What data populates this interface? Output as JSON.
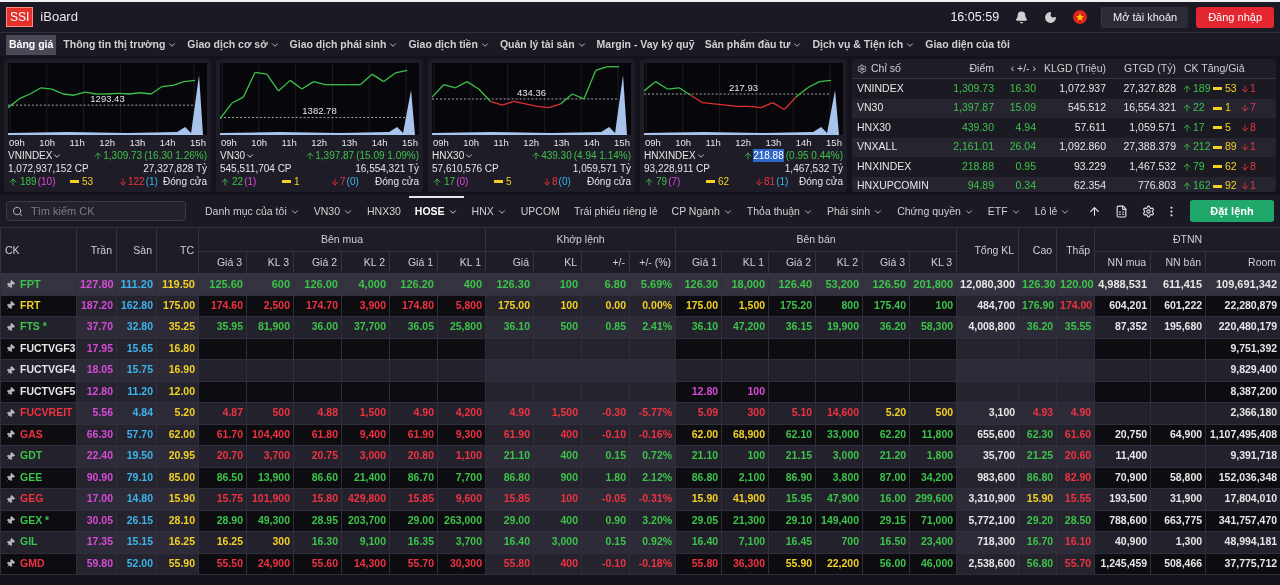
{
  "header": {
    "logo": "SSI",
    "app_name": "iBoard",
    "time": "16:05:59",
    "open_account": "Mở tài khoản",
    "login": "Đăng nhập"
  },
  "nav": [
    {
      "label": "Bảng giá",
      "selected": true,
      "has_menu": false
    },
    {
      "label": "Thông tin thị trường",
      "selected": false,
      "has_menu": true
    },
    {
      "label": "Giao dịch cơ sở",
      "selected": false,
      "has_menu": true
    },
    {
      "label": "Giao dịch phái sinh",
      "selected": false,
      "has_menu": true
    },
    {
      "label": "Giao dịch tiền",
      "selected": false,
      "has_menu": true
    },
    {
      "label": "Quản lý tài sản",
      "selected": false,
      "has_menu": true
    },
    {
      "label": "Margin - Vay ký quỹ",
      "selected": false,
      "has_menu": false
    },
    {
      "label": "Sản phẩm đầu tư",
      "selected": false,
      "has_menu": true
    },
    {
      "label": "Dịch vụ & Tiện ích",
      "selected": false,
      "has_menu": true
    },
    {
      "label": "Giao diện của tôi",
      "selected": false,
      "has_menu": false
    }
  ],
  "index_cards": [
    {
      "name": "VNINDEX",
      "ref_label": "1293.43",
      "times": [
        "09h",
        "10h",
        "11h",
        "12h",
        "13h",
        "14h",
        "15h"
      ],
      "price": "1,309.73",
      "price_selected": false,
      "change": "(16.30 1.26%)",
      "volume": "1,072,937,152 CP",
      "value": "27,327,828 Tỷ",
      "advances": "189",
      "ceiling": "(10)",
      "unchanged": "53",
      "declines": "122",
      "floor": "(1)",
      "status": "Đóng cửa"
    },
    {
      "name": "VN30",
      "ref_label": "1382.78",
      "times": [
        "09h",
        "10h",
        "11h",
        "12h",
        "13h",
        "14h",
        "15h"
      ],
      "price": "1,397.87",
      "price_selected": false,
      "change": "(15.09 1.09%)",
      "volume": "545,511,704 CP",
      "value": "16,554,321 Tỷ",
      "advances": "22",
      "ceiling": "(1)",
      "unchanged": "1",
      "declines": "7",
      "floor": "(0)",
      "status": "Đóng cửa"
    },
    {
      "name": "HNX30",
      "ref_label": "434.36",
      "times": [
        "09h",
        "10h",
        "11h",
        "12h",
        "13h",
        "14h",
        "15h"
      ],
      "price": "439.30",
      "price_selected": false,
      "change": "(4.94 1.14%)",
      "volume": "57,610,576 CP",
      "value": "1,059,571 Tỷ",
      "advances": "17",
      "ceiling": "(0)",
      "unchanged": "5",
      "declines": "8",
      "floor": "(0)",
      "status": "Đóng cửa"
    },
    {
      "name": "HNXINDEX",
      "ref_label": "217.93",
      "times": [
        "09h",
        "10h",
        "11h",
        "12h",
        "13h",
        "14h",
        "15h"
      ],
      "price": "218.88",
      "price_selected": true,
      "change": "(0.95 0.44%)",
      "volume": "93,228,911 CP",
      "value": "1,467,532 Tỷ",
      "advances": "79",
      "ceiling": "(7)",
      "unchanged": "62",
      "declines": "81",
      "floor": "(1)",
      "status": "Đóng cửa"
    }
  ],
  "index_table": {
    "columns": [
      "Chỉ số",
      "Điểm",
      "‹ +/- ›",
      "KLGD (Triệu)",
      "GTGD (Tỷ)",
      "CK Tăng/Giả"
    ],
    "rows": [
      {
        "name": "VNINDEX",
        "points": "1,309.73",
        "change": "16.30",
        "volume": "1,072.937",
        "value": "27,327.828",
        "advances": "189",
        "unchanged": "53",
        "declines": "1"
      },
      {
        "name": "VN30",
        "points": "1,397.87",
        "change": "15.09",
        "volume": "545.512",
        "value": "16,554.321",
        "advances": "22",
        "unchanged": "1",
        "declines": "7"
      },
      {
        "name": "HNX30",
        "points": "439.30",
        "change": "4.94",
        "volume": "57.611",
        "value": "1,059.571",
        "advances": "17",
        "unchanged": "5",
        "declines": "8"
      },
      {
        "name": "VNXALL",
        "points": "2,161.01",
        "change": "26.04",
        "volume": "1,092.860",
        "value": "27,388.379",
        "advances": "212",
        "unchanged": "89",
        "declines": "1"
      },
      {
        "name": "HNXINDEX",
        "points": "218.88",
        "change": "0.95",
        "volume": "93.229",
        "value": "1,467.532",
        "advances": "79",
        "unchanged": "62",
        "declines": "8"
      },
      {
        "name": "HNXUPCOMIN",
        "points": "94.89",
        "change": "0.34",
        "volume": "62.354",
        "value": "776.803",
        "advances": "162",
        "unchanged": "92",
        "declines": "1"
      }
    ]
  },
  "search": {
    "placeholder": "Tìm kiếm CK"
  },
  "filters": [
    {
      "label": "Danh mục của tôi",
      "selected": false,
      "has_menu": true
    },
    {
      "label": "VN30",
      "selected": false,
      "has_menu": true
    },
    {
      "label": "HNX30",
      "selected": false,
      "has_menu": false
    },
    {
      "label": "HOSE",
      "selected": true,
      "has_menu": true
    },
    {
      "label": "HNX",
      "selected": false,
      "has_menu": true
    },
    {
      "label": "UPCOM",
      "selected": false,
      "has_menu": false
    },
    {
      "label": "Trái phiếu riêng lẻ",
      "selected": false,
      "has_menu": false
    },
    {
      "label": "CP Ngành",
      "selected": false,
      "has_menu": true
    },
    {
      "label": "Thỏa thuận",
      "selected": false,
      "has_menu": true
    },
    {
      "label": "Phái sinh",
      "selected": false,
      "has_menu": true
    },
    {
      "label": "Chứng quyền",
      "selected": false,
      "has_menu": true
    },
    {
      "label": "ETF",
      "selected": false,
      "has_menu": true
    },
    {
      "label": "Lô lẻ",
      "selected": false,
      "has_menu": true
    }
  ],
  "order_button": "Đặt lệnh",
  "table": {
    "columns": [
      {
        "label": "CK"
      },
      {
        "label": "Trần"
      },
      {
        "label": "Sàn"
      },
      {
        "label": "TC"
      },
      {
        "label": "Bên mua",
        "colspan": 6,
        "sub": [
          "Giá 3",
          "KL 3",
          "Giá 2",
          "KL 2",
          "Giá 1",
          "KL 1"
        ]
      },
      {
        "label": "Khớp lệnh",
        "colspan": 4,
        "sub": [
          "Giá",
          "KL",
          "+/-",
          "+/- (%)"
        ]
      },
      {
        "label": "Bên bán",
        "colspan": 6,
        "sub": [
          "Giá 1",
          "KL 1",
          "Giá 2",
          "KL 2",
          "Giá 3",
          "KL 3"
        ]
      },
      {
        "label": "Tổng KL"
      },
      {
        "label": "Cao"
      },
      {
        "label": "Thấp"
      },
      {
        "label": "ĐTNN",
        "colspan": 3,
        "sub": [
          "NN mua",
          "NN bán",
          "Room"
        ]
      }
    ],
    "rows": [
      {
        "selected": true,
        "cells": [
          {
            "text": "FPT",
            "color": "#3dc24a"
          },
          {
            "text": "127.80",
            "color": "#d84ad8"
          },
          {
            "text": "111.20",
            "color": "#3cb4ea"
          },
          {
            "text": "119.50",
            "color": "#f2d024"
          },
          {
            "text": "125.60",
            "color": "#3dc24a"
          },
          {
            "text": "600",
            "color": "#3dc24a"
          },
          {
            "text": "126.00",
            "color": "#3dc24a"
          },
          {
            "text": "4,000",
            "color": "#3dc24a"
          },
          {
            "text": "126.20",
            "color": "#3dc24a"
          },
          {
            "text": "400",
            "color": "#3dc24a"
          },
          {
            "text": "126.30",
            "color": "#3dc24a"
          },
          {
            "text": "100",
            "color": "#3dc24a"
          },
          {
            "text": "6.80",
            "color": "#3dc24a"
          },
          {
            "text": "5.69%",
            "color": "#3dc24a"
          },
          {
            "text": "126.30",
            "color": "#3dc24a"
          },
          {
            "text": "18,000",
            "color": "#3dc24a"
          },
          {
            "text": "126.40",
            "color": "#3dc24a"
          },
          {
            "text": "53,200",
            "color": "#3dc24a"
          },
          {
            "text": "126.50",
            "color": "#3dc24a"
          },
          {
            "text": "201,800",
            "color": "#3dc24a"
          },
          {
            "text": "12,080,300",
            "color": "#e6e6e6"
          },
          {
            "text": "126.30",
            "color": "#3dc24a"
          },
          {
            "text": "120.00",
            "color": "#3dc24a"
          },
          {
            "text": "4,988,531",
            "color": "#e6e6e6"
          },
          {
            "text": "611,415",
            "color": "#e6e6e6"
          },
          {
            "text": "109,691,342",
            "color": "#e6e6e6"
          }
        ]
      },
      {
        "selected": false,
        "cells": [
          {
            "text": "FRT",
            "color": "#f2d024"
          },
          {
            "text": "187.20",
            "color": "#d84ad8"
          },
          {
            "text": "162.80",
            "color": "#3cb4ea"
          },
          {
            "text": "175.00",
            "color": "#f2d024"
          },
          {
            "text": "174.60",
            "color": "#ee3340"
          },
          {
            "text": "2,500",
            "color": "#ee3340"
          },
          {
            "text": "174.70",
            "color": "#ee3340"
          },
          {
            "text": "3,900",
            "color": "#ee3340"
          },
          {
            "text": "174.80",
            "color": "#ee3340"
          },
          {
            "text": "5,800",
            "color": "#ee3340"
          },
          {
            "text": "175.00",
            "color": "#f2d024"
          },
          {
            "text": "100",
            "color": "#f2d024"
          },
          {
            "text": "0.00",
            "color": "#f2d024"
          },
          {
            "text": "0.00%",
            "color": "#f2d024"
          },
          {
            "text": "175.00",
            "color": "#f2d024"
          },
          {
            "text": "1,500",
            "color": "#f2d024"
          },
          {
            "text": "175.20",
            "color": "#3dc24a"
          },
          {
            "text": "800",
            "color": "#3dc24a"
          },
          {
            "text": "175.40",
            "color": "#3dc24a"
          },
          {
            "text": "100",
            "color": "#3dc24a"
          },
          {
            "text": "484,700",
            "color": "#e6e6e6"
          },
          {
            "text": "176.90",
            "color": "#3dc24a"
          },
          {
            "text": "174.00",
            "color": "#ee3340"
          },
          {
            "text": "604,201",
            "color": "#e6e6e6"
          },
          {
            "text": "601,222",
            "color": "#e6e6e6"
          },
          {
            "text": "22,280,879",
            "color": "#e6e6e6"
          }
        ]
      },
      {
        "selected": false,
        "cells": [
          {
            "text": "FTS *",
            "color": "#3dc24a"
          },
          {
            "text": "37.70",
            "color": "#d84ad8"
          },
          {
            "text": "32.80",
            "color": "#3cb4ea"
          },
          {
            "text": "35.25",
            "color": "#f2d024"
          },
          {
            "text": "35.95",
            "color": "#3dc24a"
          },
          {
            "text": "81,900",
            "color": "#3dc24a"
          },
          {
            "text": "36.00",
            "color": "#3dc24a"
          },
          {
            "text": "37,700",
            "color": "#3dc24a"
          },
          {
            "text": "36.05",
            "color": "#3dc24a"
          },
          {
            "text": "25,800",
            "color": "#3dc24a"
          },
          {
            "text": "36.10",
            "color": "#3dc24a"
          },
          {
            "text": "500",
            "color": "#3dc24a"
          },
          {
            "text": "0.85",
            "color": "#3dc24a"
          },
          {
            "text": "2.41%",
            "color": "#3dc24a"
          },
          {
            "text": "36.10",
            "color": "#3dc24a"
          },
          {
            "text": "47,200",
            "color": "#3dc24a"
          },
          {
            "text": "36.15",
            "color": "#3dc24a"
          },
          {
            "text": "19,900",
            "color": "#3dc24a"
          },
          {
            "text": "36.20",
            "color": "#3dc24a"
          },
          {
            "text": "58,300",
            "color": "#3dc24a"
          },
          {
            "text": "4,008,800",
            "color": "#e6e6e6"
          },
          {
            "text": "36.20",
            "color": "#3dc24a"
          },
          {
            "text": "35.55",
            "color": "#3dc24a"
          },
          {
            "text": "87,352",
            "color": "#e6e6e6"
          },
          {
            "text": "195,680",
            "color": "#e6e6e6"
          },
          {
            "text": "220,480,179",
            "color": "#e6e6e6"
          }
        ]
      },
      {
        "selected": false,
        "cells": [
          {
            "text": "FUCTVGF3",
            "color": "#e6e6e6"
          },
          {
            "text": "17.95",
            "color": "#d84ad8"
          },
          {
            "text": "15.65",
            "color": "#3cb4ea"
          },
          {
            "text": "16.80",
            "color": "#f2d024"
          },
          null,
          null,
          null,
          null,
          null,
          null,
          null,
          null,
          null,
          null,
          null,
          null,
          null,
          null,
          null,
          null,
          null,
          null,
          null,
          null,
          null,
          {
            "text": "9,751,392",
            "color": "#e6e6e6"
          }
        ]
      },
      {
        "selected": false,
        "cells": [
          {
            "text": "FUCTVGF4",
            "color": "#e6e6e6"
          },
          {
            "text": "18.05",
            "color": "#d84ad8"
          },
          {
            "text": "15.75",
            "color": "#3cb4ea"
          },
          {
            "text": "16.90",
            "color": "#f2d024"
          },
          null,
          null,
          null,
          null,
          null,
          null,
          null,
          null,
          null,
          null,
          null,
          null,
          null,
          null,
          null,
          null,
          null,
          null,
          null,
          null,
          null,
          {
            "text": "9,829,400",
            "color": "#e6e6e6"
          }
        ]
      },
      {
        "selected": false,
        "cells": [
          {
            "text": "FUCTVGF5",
            "color": "#e6e6e6"
          },
          {
            "text": "12.80",
            "color": "#d84ad8"
          },
          {
            "text": "11.20",
            "color": "#3cb4ea"
          },
          {
            "text": "12.00",
            "color": "#f2d024"
          },
          null,
          null,
          null,
          null,
          null,
          null,
          null,
          null,
          null,
          null,
          {
            "text": "12.80",
            "color": "#d84ad8"
          },
          {
            "text": "100",
            "color": "#d84ad8"
          },
          null,
          null,
          null,
          null,
          null,
          null,
          null,
          null,
          null,
          {
            "text": "8,387,200",
            "color": "#e6e6e6"
          }
        ]
      },
      {
        "selected": false,
        "cells": [
          {
            "text": "FUCVREIT",
            "color": "#ee3340"
          },
          {
            "text": "5.56",
            "color": "#d84ad8"
          },
          {
            "text": "4.84",
            "color": "#3cb4ea"
          },
          {
            "text": "5.20",
            "color": "#f2d024"
          },
          {
            "text": "4.87",
            "color": "#ee3340"
          },
          {
            "text": "500",
            "color": "#ee3340"
          },
          {
            "text": "4.88",
            "color": "#ee3340"
          },
          {
            "text": "1,500",
            "color": "#ee3340"
          },
          {
            "text": "4.90",
            "color": "#ee3340"
          },
          {
            "text": "4,200",
            "color": "#ee3340"
          },
          {
            "text": "4.90",
            "color": "#ee3340"
          },
          {
            "text": "1,500",
            "color": "#ee3340"
          },
          {
            "text": "-0.30",
            "color": "#ee3340"
          },
          {
            "text": "-5.77%",
            "color": "#ee3340"
          },
          {
            "text": "5.09",
            "color": "#ee3340"
          },
          {
            "text": "300",
            "color": "#ee3340"
          },
          {
            "text": "5.10",
            "color": "#ee3340"
          },
          {
            "text": "14,600",
            "color": "#ee3340"
          },
          {
            "text": "5.20",
            "color": "#f2d024"
          },
          {
            "text": "500",
            "color": "#f2d024"
          },
          {
            "text": "3,100",
            "color": "#e6e6e6"
          },
          {
            "text": "4.93",
            "color": "#ee3340"
          },
          {
            "text": "4.90",
            "color": "#ee3340"
          },
          null,
          null,
          {
            "text": "2,366,180",
            "color": "#e6e6e6"
          }
        ]
      },
      {
        "selected": false,
        "cells": [
          {
            "text": "GAS",
            "color": "#ee3340"
          },
          {
            "text": "66.30",
            "color": "#d84ad8"
          },
          {
            "text": "57.70",
            "color": "#3cb4ea"
          },
          {
            "text": "62.00",
            "color": "#f2d024"
          },
          {
            "text": "61.70",
            "color": "#ee3340"
          },
          {
            "text": "104,400",
            "color": "#ee3340"
          },
          {
            "text": "61.80",
            "color": "#ee3340"
          },
          {
            "text": "9,400",
            "color": "#ee3340"
          },
          {
            "text": "61.90",
            "color": "#ee3340"
          },
          {
            "text": "9,300",
            "color": "#ee3340"
          },
          {
            "text": "61.90",
            "color": "#ee3340"
          },
          {
            "text": "400",
            "color": "#ee3340"
          },
          {
            "text": "-0.10",
            "color": "#ee3340"
          },
          {
            "text": "-0.16%",
            "color": "#ee3340"
          },
          {
            "text": "62.00",
            "color": "#f2d024"
          },
          {
            "text": "68,900",
            "color": "#f2d024"
          },
          {
            "text": "62.10",
            "color": "#3dc24a"
          },
          {
            "text": "33,000",
            "color": "#3dc24a"
          },
          {
            "text": "62.20",
            "color": "#3dc24a"
          },
          {
            "text": "11,800",
            "color": "#3dc24a"
          },
          {
            "text": "655,600",
            "color": "#e6e6e6"
          },
          {
            "text": "62.30",
            "color": "#3dc24a"
          },
          {
            "text": "61.60",
            "color": "#ee3340"
          },
          {
            "text": "20,750",
            "color": "#e6e6e6"
          },
          {
            "text": "64,900",
            "color": "#e6e6e6"
          },
          {
            "text": "1,107,495,408",
            "color": "#e6e6e6"
          }
        ]
      },
      {
        "selected": false,
        "cells": [
          {
            "text": "GDT",
            "color": "#3dc24a"
          },
          {
            "text": "22.40",
            "color": "#d84ad8"
          },
          {
            "text": "19.50",
            "color": "#3cb4ea"
          },
          {
            "text": "20.95",
            "color": "#f2d024"
          },
          {
            "text": "20.70",
            "color": "#ee3340"
          },
          {
            "text": "3,700",
            "color": "#ee3340"
          },
          {
            "text": "20.75",
            "color": "#ee3340"
          },
          {
            "text": "3,000",
            "color": "#ee3340"
          },
          {
            "text": "20.80",
            "color": "#ee3340"
          },
          {
            "text": "1,100",
            "color": "#ee3340"
          },
          {
            "text": "21.10",
            "color": "#3dc24a"
          },
          {
            "text": "400",
            "color": "#3dc24a"
          },
          {
            "text": "0.15",
            "color": "#3dc24a"
          },
          {
            "text": "0.72%",
            "color": "#3dc24a"
          },
          {
            "text": "21.10",
            "color": "#3dc24a"
          },
          {
            "text": "100",
            "color": "#3dc24a"
          },
          {
            "text": "21.15",
            "color": "#3dc24a"
          },
          {
            "text": "3,000",
            "color": "#3dc24a"
          },
          {
            "text": "21.20",
            "color": "#3dc24a"
          },
          {
            "text": "1,800",
            "color": "#3dc24a"
          },
          {
            "text": "35,700",
            "color": "#e6e6e6"
          },
          {
            "text": "21.25",
            "color": "#3dc24a"
          },
          {
            "text": "20.60",
            "color": "#ee3340"
          },
          {
            "text": "11,400",
            "color": "#e6e6e6"
          },
          null,
          {
            "text": "9,391,718",
            "color": "#e6e6e6"
          }
        ]
      },
      {
        "selected": false,
        "cells": [
          {
            "text": "GEE",
            "color": "#3dc24a"
          },
          {
            "text": "90.90",
            "color": "#d84ad8"
          },
          {
            "text": "79.10",
            "color": "#3cb4ea"
          },
          {
            "text": "85.00",
            "color": "#f2d024"
          },
          {
            "text": "86.50",
            "color": "#3dc24a"
          },
          {
            "text": "13,900",
            "color": "#3dc24a"
          },
          {
            "text": "86.60",
            "color": "#3dc24a"
          },
          {
            "text": "21,400",
            "color": "#3dc24a"
          },
          {
            "text": "86.70",
            "color": "#3dc24a"
          },
          {
            "text": "7,700",
            "color": "#3dc24a"
          },
          {
            "text": "86.80",
            "color": "#3dc24a"
          },
          {
            "text": "900",
            "color": "#3dc24a"
          },
          {
            "text": "1.80",
            "color": "#3dc24a"
          },
          {
            "text": "2.12%",
            "color": "#3dc24a"
          },
          {
            "text": "86.80",
            "color": "#3dc24a"
          },
          {
            "text": "2,100",
            "color": "#3dc24a"
          },
          {
            "text": "86.90",
            "color": "#3dc24a"
          },
          {
            "text": "3,800",
            "color": "#3dc24a"
          },
          {
            "text": "87.00",
            "color": "#3dc24a"
          },
          {
            "text": "34,200",
            "color": "#3dc24a"
          },
          {
            "text": "983,600",
            "color": "#e6e6e6"
          },
          {
            "text": "86.80",
            "color": "#3dc24a"
          },
          {
            "text": "82.90",
            "color": "#ee3340"
          },
          {
            "text": "70,900",
            "color": "#e6e6e6"
          },
          {
            "text": "58,800",
            "color": "#e6e6e6"
          },
          {
            "text": "152,036,348",
            "color": "#e6e6e6"
          }
        ]
      },
      {
        "selected": false,
        "cells": [
          {
            "text": "GEG",
            "color": "#ee3340"
          },
          {
            "text": "17.00",
            "color": "#d84ad8"
          },
          {
            "text": "14.80",
            "color": "#3cb4ea"
          },
          {
            "text": "15.90",
            "color": "#f2d024"
          },
          {
            "text": "15.75",
            "color": "#ee3340"
          },
          {
            "text": "101,900",
            "color": "#ee3340"
          },
          {
            "text": "15.80",
            "color": "#ee3340"
          },
          {
            "text": "429,800",
            "color": "#ee3340"
          },
          {
            "text": "15.85",
            "color": "#ee3340"
          },
          {
            "text": "9,600",
            "color": "#ee3340"
          },
          {
            "text": "15.85",
            "color": "#ee3340"
          },
          {
            "text": "100",
            "color": "#ee3340"
          },
          {
            "text": "-0.05",
            "color": "#ee3340"
          },
          {
            "text": "-0.31%",
            "color": "#ee3340"
          },
          {
            "text": "15.90",
            "color": "#f2d024"
          },
          {
            "text": "41,900",
            "color": "#f2d024"
          },
          {
            "text": "15.95",
            "color": "#3dc24a"
          },
          {
            "text": "47,900",
            "color": "#3dc24a"
          },
          {
            "text": "16.00",
            "color": "#3dc24a"
          },
          {
            "text": "299,600",
            "color": "#3dc24a"
          },
          {
            "text": "3,310,900",
            "color": "#e6e6e6"
          },
          {
            "text": "15.90",
            "color": "#f2d024"
          },
          {
            "text": "15.55",
            "color": "#ee3340"
          },
          {
            "text": "193,500",
            "color": "#e6e6e6"
          },
          {
            "text": "31,900",
            "color": "#e6e6e6"
          },
          {
            "text": "17,804,010",
            "color": "#e6e6e6"
          }
        ]
      },
      {
        "selected": false,
        "cells": [
          {
            "text": "GEX *",
            "color": "#3dc24a"
          },
          {
            "text": "30.05",
            "color": "#d84ad8"
          },
          {
            "text": "26.15",
            "color": "#3cb4ea"
          },
          {
            "text": "28.10",
            "color": "#f2d024"
          },
          {
            "text": "28.90",
            "color": "#3dc24a"
          },
          {
            "text": "49,300",
            "color": "#3dc24a"
          },
          {
            "text": "28.95",
            "color": "#3dc24a"
          },
          {
            "text": "203,700",
            "color": "#3dc24a"
          },
          {
            "text": "29.00",
            "color": "#3dc24a"
          },
          {
            "text": "263,000",
            "color": "#3dc24a"
          },
          {
            "text": "29.00",
            "color": "#3dc24a"
          },
          {
            "text": "400",
            "color": "#3dc24a"
          },
          {
            "text": "0.90",
            "color": "#3dc24a"
          },
          {
            "text": "3.20%",
            "color": "#3dc24a"
          },
          {
            "text": "29.05",
            "color": "#3dc24a"
          },
          {
            "text": "21,300",
            "color": "#3dc24a"
          },
          {
            "text": "29.10",
            "color": "#3dc24a"
          },
          {
            "text": "149,400",
            "color": "#3dc24a"
          },
          {
            "text": "29.15",
            "color": "#3dc24a"
          },
          {
            "text": "71,000",
            "color": "#3dc24a"
          },
          {
            "text": "5,772,100",
            "color": "#e6e6e6"
          },
          {
            "text": "29.20",
            "color": "#3dc24a"
          },
          {
            "text": "28.50",
            "color": "#3dc24a"
          },
          {
            "text": "788,600",
            "color": "#e6e6e6"
          },
          {
            "text": "663,775",
            "color": "#e6e6e6"
          },
          {
            "text": "341,757,470",
            "color": "#e6e6e6"
          }
        ]
      },
      {
        "selected": false,
        "cells": [
          {
            "text": "GIL",
            "color": "#3dc24a"
          },
          {
            "text": "17.35",
            "color": "#d84ad8"
          },
          {
            "text": "15.15",
            "color": "#3cb4ea"
          },
          {
            "text": "16.25",
            "color": "#f2d024"
          },
          {
            "text": "16.25",
            "color": "#f2d024"
          },
          {
            "text": "300",
            "color": "#f2d024"
          },
          {
            "text": "16.30",
            "color": "#3dc24a"
          },
          {
            "text": "9,100",
            "color": "#3dc24a"
          },
          {
            "text": "16.35",
            "color": "#3dc24a"
          },
          {
            "text": "3,700",
            "color": "#3dc24a"
          },
          {
            "text": "16.40",
            "color": "#3dc24a"
          },
          {
            "text": "3,000",
            "color": "#3dc24a"
          },
          {
            "text": "0.15",
            "color": "#3dc24a"
          },
          {
            "text": "0.92%",
            "color": "#3dc24a"
          },
          {
            "text": "16.40",
            "color": "#3dc24a"
          },
          {
            "text": "7,100",
            "color": "#3dc24a"
          },
          {
            "text": "16.45",
            "color": "#3dc24a"
          },
          {
            "text": "700",
            "color": "#3dc24a"
          },
          {
            "text": "16.50",
            "color": "#3dc24a"
          },
          {
            "text": "23,400",
            "color": "#3dc24a"
          },
          {
            "text": "718,300",
            "color": "#e6e6e6"
          },
          {
            "text": "16.70",
            "color": "#3dc24a"
          },
          {
            "text": "16.10",
            "color": "#ee3340"
          },
          {
            "text": "40,900",
            "color": "#e6e6e6"
          },
          {
            "text": "1,300",
            "color": "#e6e6e6"
          },
          {
            "text": "48,994,181",
            "color": "#e6e6e6"
          }
        ]
      },
      {
        "selected": false,
        "cells": [
          {
            "text": "GMD",
            "color": "#ee3340"
          },
          {
            "text": "59.80",
            "color": "#d84ad8"
          },
          {
            "text": "52.00",
            "color": "#3cb4ea"
          },
          {
            "text": "55.90",
            "color": "#f2d024"
          },
          {
            "text": "55.50",
            "color": "#ee3340"
          },
          {
            "text": "24,900",
            "color": "#ee3340"
          },
          {
            "text": "55.60",
            "color": "#ee3340"
          },
          {
            "text": "14,300",
            "color": "#ee3340"
          },
          {
            "text": "55.70",
            "color": "#ee3340"
          },
          {
            "text": "30,300",
            "color": "#ee3340"
          },
          {
            "text": "55.80",
            "color": "#ee3340"
          },
          {
            "text": "400",
            "color": "#ee3340"
          },
          {
            "text": "-0.10",
            "color": "#ee3340"
          },
          {
            "text": "-0.18%",
            "color": "#ee3340"
          },
          {
            "text": "55.80",
            "color": "#ee3340"
          },
          {
            "text": "36,300",
            "color": "#ee3340"
          },
          {
            "text": "55.90",
            "color": "#f2d024"
          },
          {
            "text": "22,200",
            "color": "#f2d024"
          },
          {
            "text": "56.00",
            "color": "#3dc24a"
          },
          {
            "text": "46,000",
            "color": "#3dc24a"
          },
          {
            "text": "2,538,600",
            "color": "#e6e6e6"
          },
          {
            "text": "56.80",
            "color": "#3dc24a"
          },
          {
            "text": "55.70",
            "color": "#ee3340"
          },
          {
            "text": "1,245,459",
            "color": "#e6e6e6"
          },
          {
            "text": "508,466",
            "color": "#e6e6e6"
          },
          {
            "text": "37,775,712",
            "color": "#e6e6e6"
          }
        ]
      }
    ]
  }
}
